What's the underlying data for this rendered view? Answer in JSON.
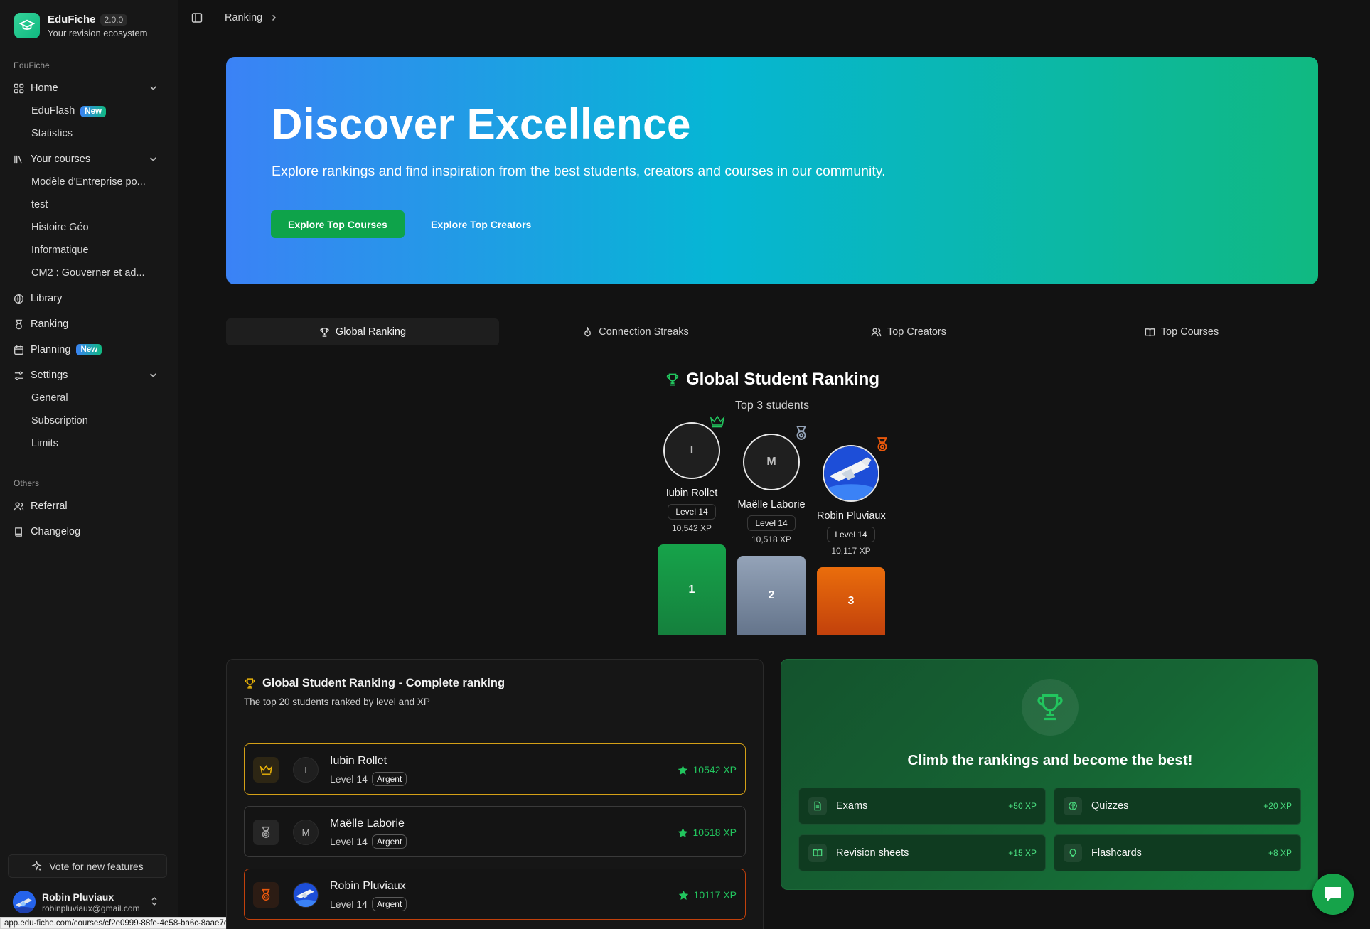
{
  "app": {
    "name": "EduFiche",
    "version": "2.0.0",
    "tagline": "Your revision ecosystem"
  },
  "sidebar": {
    "section_main": "EduFiche",
    "home": "Home",
    "home_children": [
      "EduFlash",
      "Statistics"
    ],
    "new_badge": "New",
    "courses": "Your courses",
    "course_items": [
      "Modèle d'Entreprise po...",
      "test",
      "Histoire Géo",
      "Informatique",
      "CM2 : Gouverner et ad..."
    ],
    "library": "Library",
    "ranking": "Ranking",
    "planning": "Planning",
    "settings": "Settings",
    "settings_children": [
      "General",
      "Subscription",
      "Limits"
    ],
    "section_others": "Others",
    "referral": "Referral",
    "changelog": "Changelog",
    "vote": "Vote for new features",
    "user": {
      "name": "Robin Pluviaux",
      "email": "robinpluviaux@gmail.com"
    }
  },
  "status_url": "app.edu-fiche.com/courses/cf2e0999-88fe-4e58-ba6c-8aae7e13a6c7",
  "breadcrumb": {
    "current": "Ranking"
  },
  "hero": {
    "title": "Discover Excellence",
    "subtitle": "Explore rankings and find inspiration from the best students, creators and courses in our community.",
    "primary_button": "Explore Top Courses",
    "secondary_button": "Explore Top Creators"
  },
  "tabs": [
    "Global Ranking",
    "Connection Streaks",
    "Top Creators",
    "Top Courses"
  ],
  "podium": {
    "title": "Global Student Ranking",
    "subtitle": "Top 3 students",
    "entries": [
      {
        "rank": "1",
        "initial": "I",
        "name": "Iubin Rollet",
        "level": "Level 14",
        "xp": "10,542 XP"
      },
      {
        "rank": "2",
        "initial": "M",
        "name": "Maëlle Laborie",
        "level": "Level 14",
        "xp": "10,518 XP"
      },
      {
        "rank": "3",
        "initial": "",
        "name": "Robin Pluviaux",
        "level": "Level 14",
        "xp": "10,117 XP"
      }
    ]
  },
  "ranking": {
    "title": "Global Student Ranking - Complete ranking",
    "subtitle": "The top 20 students ranked by level and XP",
    "rows": [
      {
        "initial": "I",
        "name": "Iubin Rollet",
        "level": "Level 14",
        "badge": "Argent",
        "xp": "10542 XP"
      },
      {
        "initial": "M",
        "name": "Maëlle Laborie",
        "level": "Level 14",
        "badge": "Argent",
        "xp": "10518 XP"
      },
      {
        "initial": "",
        "name": "Robin Pluviaux",
        "level": "Level 14",
        "badge": "Argent",
        "xp": "10117 XP"
      }
    ]
  },
  "climb": {
    "title": "Climb the rankings and become the best!",
    "items": [
      {
        "label": "Exams",
        "xp": "+50 XP",
        "icon": "file-icon"
      },
      {
        "label": "Quizzes",
        "xp": "+20 XP",
        "icon": "brain-icon"
      },
      {
        "label": "Revision sheets",
        "xp": "+15 XP",
        "icon": "book-icon"
      },
      {
        "label": "Flashcards",
        "xp": "+8 XP",
        "icon": "lightbulb-icon"
      }
    ]
  },
  "colors": {
    "accent": "#10b981",
    "gold": "#d4a017",
    "silver": "#7c8aa5",
    "bronze": "#c2410c",
    "xp_green": "#22c55e"
  }
}
